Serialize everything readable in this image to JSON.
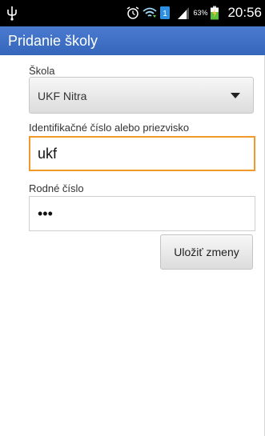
{
  "status_bar": {
    "usb_icon": "usb-icon",
    "alarm_icon": "alarm-clock-icon",
    "wifi_icon": "wifi-icon",
    "sim_icon": "sim-icon",
    "signal_icon": "signal-icon",
    "battery_percent": "63%",
    "battery_icon": "battery-charging-icon",
    "time": "20:56"
  },
  "action_bar": {
    "title": "Pridanie školy",
    "color": "#3d6fc4"
  },
  "form": {
    "school_label": "Škola",
    "school_value": "UKF Nitra",
    "id_label": "Identifikačné číslo alebo priezvisko",
    "id_value": "ukf",
    "birth_number_label": "Rodné číslo",
    "birth_number_value": "•••",
    "save_button_label": "Uložiť zmeny",
    "focus_color": "#f19a2a"
  }
}
